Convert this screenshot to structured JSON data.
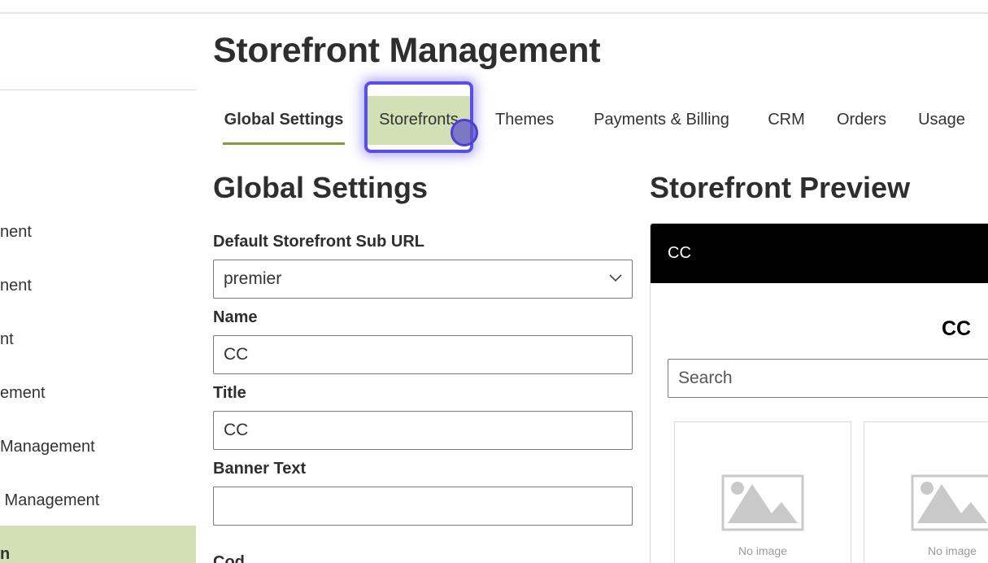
{
  "sidebar": {
    "items": [
      {
        "label": "nent",
        "active": false
      },
      {
        "label": "nent",
        "active": false
      },
      {
        "label": "nt",
        "active": false
      },
      {
        "label": "ement",
        "active": false
      },
      {
        "label": "Management",
        "active": false
      },
      {
        "label": " Management",
        "active": false
      },
      {
        "label": "n",
        "active": true
      }
    ]
  },
  "page": {
    "title": "Storefront Management"
  },
  "tabs": [
    {
      "label": "Global Settings",
      "state": "active"
    },
    {
      "label": "Storefronts",
      "state": "hover"
    },
    {
      "label": "Themes",
      "state": "normal"
    },
    {
      "label": "Payments & Billing",
      "state": "normal"
    },
    {
      "label": "CRM",
      "state": "normal"
    },
    {
      "label": "Orders",
      "state": "normal"
    },
    {
      "label": "Usage",
      "state": "normal"
    }
  ],
  "global_settings": {
    "title": "Global Settings",
    "sub_url": {
      "label": "Default Storefront Sub URL",
      "value": "premier",
      "icon": "chevron-down-icon"
    },
    "name": {
      "label": "Name",
      "value": "CC"
    },
    "title_field": {
      "label": "Title",
      "value": "CC"
    },
    "banner_text": {
      "label": "Banner Text",
      "value": ""
    },
    "next_label": "Cod"
  },
  "preview": {
    "title": "Storefront Preview",
    "header_text": "CC",
    "brand": "CC",
    "search_placeholder": "Search",
    "products": [
      {
        "image_text": "No image"
      },
      {
        "image_text": "No image"
      }
    ]
  },
  "colors": {
    "accent": "#8a9a3c",
    "highlight": "#d2e0b6",
    "focus_ring": "#5b4ee6"
  }
}
